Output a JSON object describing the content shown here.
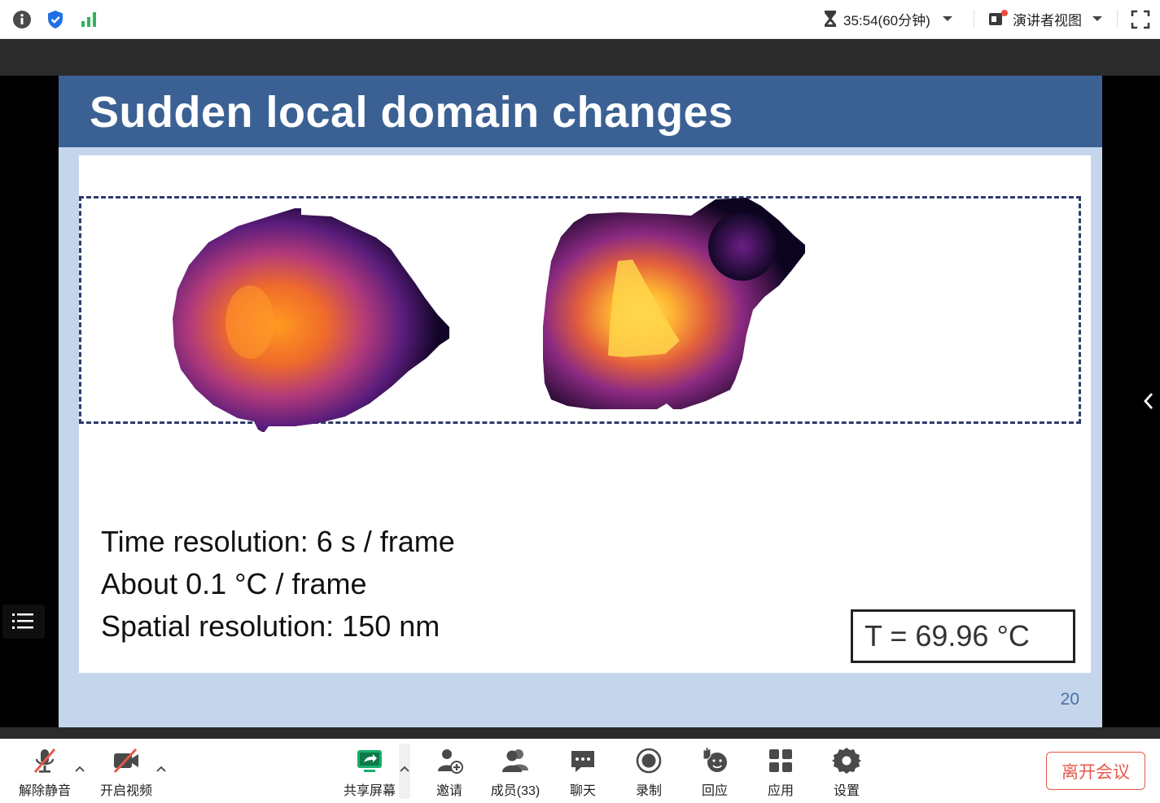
{
  "topbar": {
    "timer": "35:54(60分钟)",
    "presenter_view": "演讲者视图",
    "icons": [
      "info-icon",
      "shield-icon",
      "signal-icon",
      "hourglass-icon",
      "presenter-icon",
      "fullscreen-icon"
    ]
  },
  "slide": {
    "title": "Sudden local domain changes",
    "lines": [
      "Time resolution: 6 s / frame",
      "About 0.1 °C / frame",
      "Spatial resolution: 150 nm"
    ],
    "temperature": "T = 69.96 °C",
    "page_number": "20",
    "colors": {
      "title_bar": "#3b6194",
      "background": "#c5d6ec",
      "dash": "#2d3c6a"
    }
  },
  "toolbar": {
    "items": [
      {
        "label": "解除静音",
        "icon": "mic-muted-icon"
      },
      {
        "label": "开启视频",
        "icon": "video-off-icon"
      },
      {
        "label": "共享屏幕",
        "icon": "share-screen-icon"
      },
      {
        "label": "邀请",
        "icon": "invite-icon"
      },
      {
        "label": "成员(33)",
        "icon": "members-icon"
      },
      {
        "label": "聊天",
        "icon": "chat-icon"
      },
      {
        "label": "录制",
        "icon": "record-icon"
      },
      {
        "label": "回应",
        "icon": "reaction-icon"
      },
      {
        "label": "应用",
        "icon": "apps-icon"
      },
      {
        "label": "设置",
        "icon": "settings-icon"
      }
    ],
    "leave": "离开会议",
    "accent": "#e5594c"
  }
}
